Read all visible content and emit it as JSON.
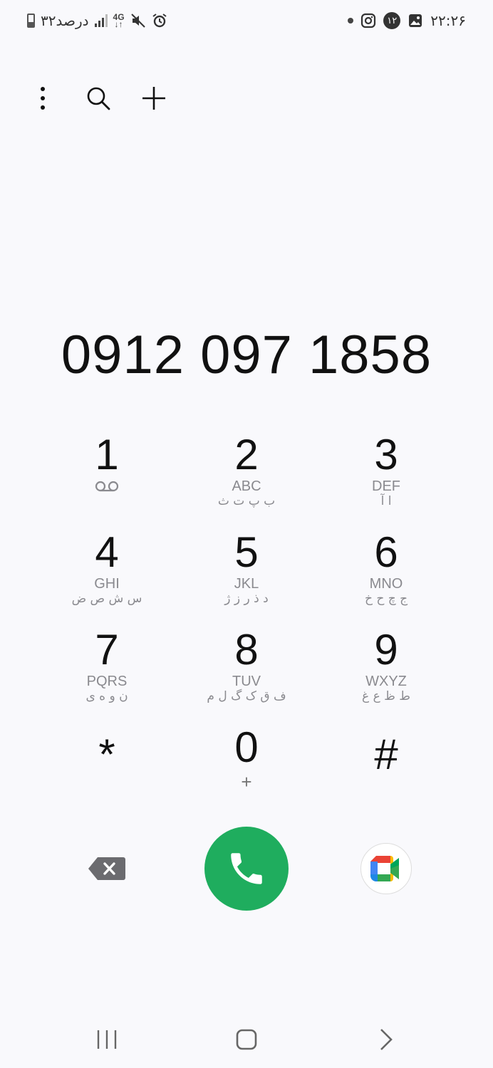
{
  "status_bar": {
    "battery_text": "۳۲درصد",
    "network_type": "4G",
    "time": "۲۲:۲۶",
    "notification_count": "۱۲",
    "icons": [
      "battery-icon",
      "signal-icon",
      "4g-icon",
      "mute-icon",
      "alarm-icon",
      "dot-icon",
      "instagram-icon",
      "notification-badge",
      "gallery-icon"
    ]
  },
  "toolbar": {
    "icons": [
      "more-options-icon",
      "search-icon",
      "add-contact-icon"
    ]
  },
  "dialer": {
    "number": "0912 097 1858"
  },
  "keypad": {
    "keys": [
      {
        "digit": "1",
        "latin": "",
        "persian": "",
        "icon": "voicemail-icon"
      },
      {
        "digit": "2",
        "latin": "ABC",
        "persian": "ب پ ت ث"
      },
      {
        "digit": "3",
        "latin": "DEF",
        "persian": "ا آ"
      },
      {
        "digit": "4",
        "latin": "GHI",
        "persian": "س ش ص ض"
      },
      {
        "digit": "5",
        "latin": "JKL",
        "persian": "د ذ ر ز ژ"
      },
      {
        "digit": "6",
        "latin": "MNO",
        "persian": "ج چ ح خ"
      },
      {
        "digit": "7",
        "latin": "PQRS",
        "persian": "ن و ه ی"
      },
      {
        "digit": "8",
        "latin": "TUV",
        "persian": "ف ق ک گ ل م"
      },
      {
        "digit": "9",
        "latin": "WXYZ",
        "persian": "ط ظ ع غ"
      },
      {
        "digit": "*",
        "latin": "",
        "persian": ""
      },
      {
        "digit": "0",
        "latin": "+",
        "persian": ""
      },
      {
        "digit": "#",
        "latin": "",
        "persian": ""
      }
    ]
  },
  "actions": {
    "icons": [
      "backspace-icon",
      "phone-icon",
      "google-meet-icon"
    ],
    "call_color": "#1fad5e"
  },
  "navbar": {
    "icons": [
      "recent-apps-icon",
      "home-icon",
      "back-icon"
    ]
  }
}
